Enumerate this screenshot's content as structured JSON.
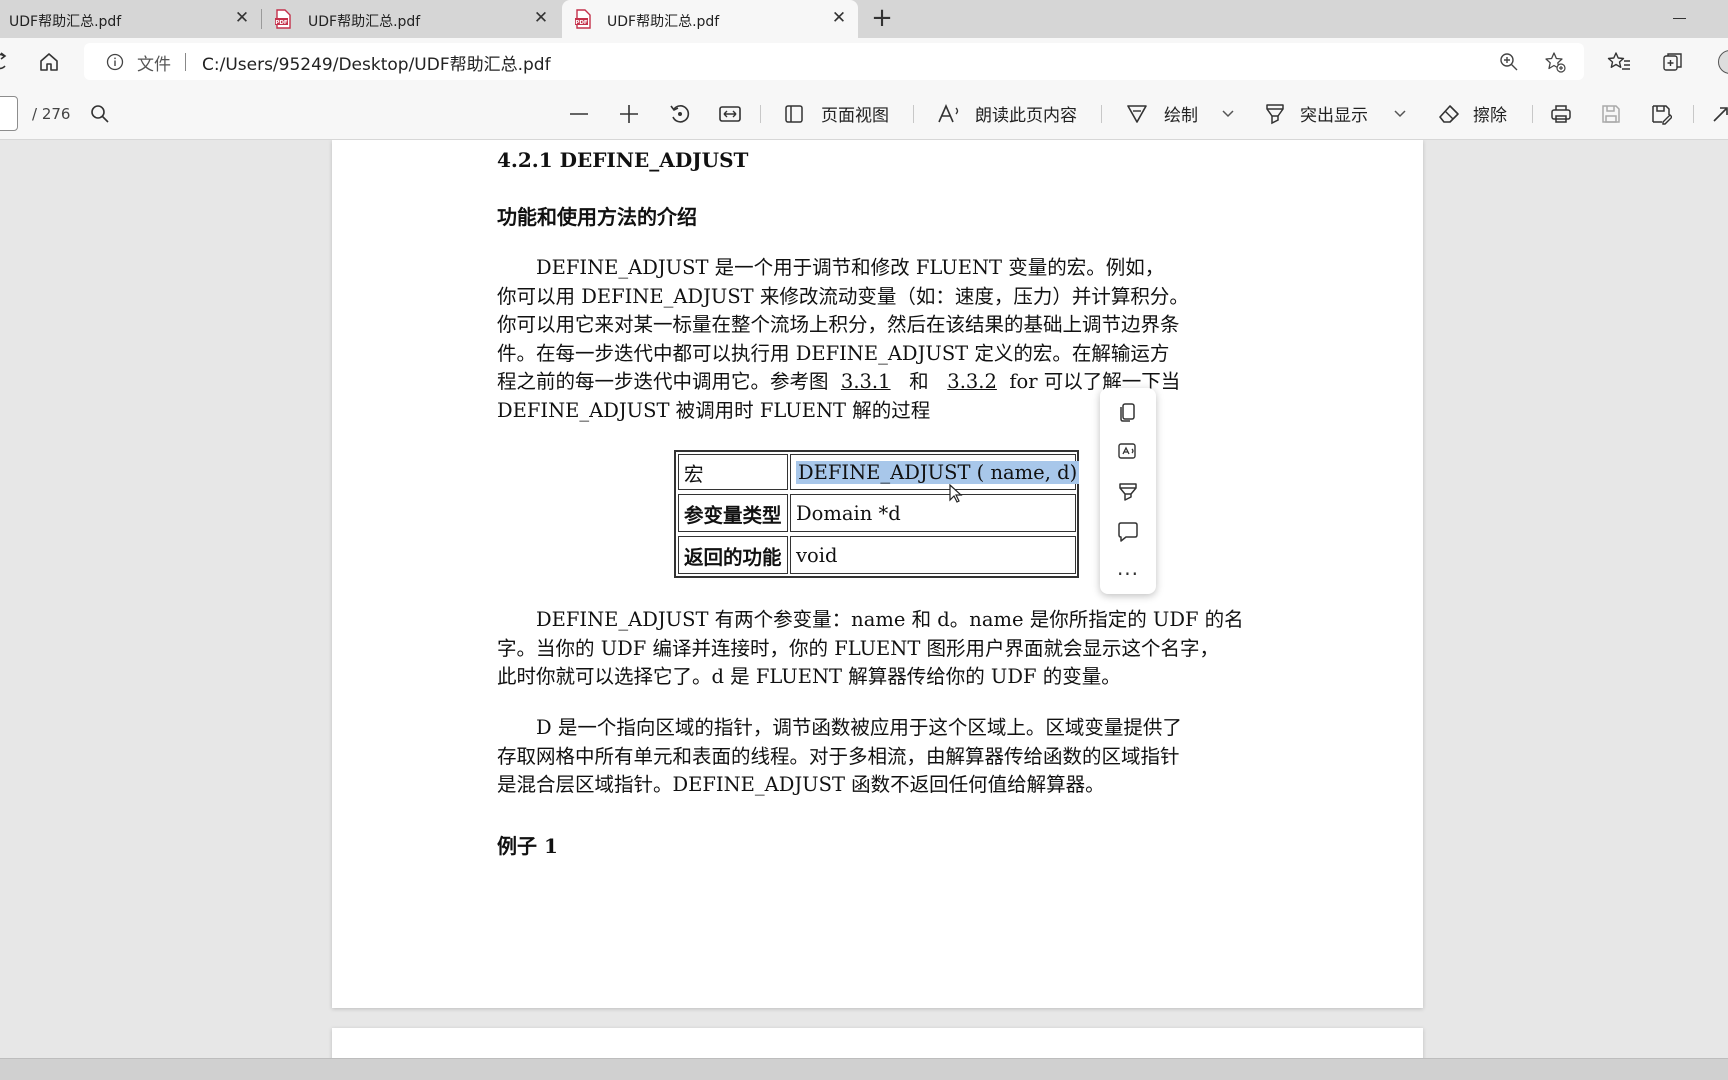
{
  "tabs": [
    {
      "title": "UDF帮助汇总.pdf"
    },
    {
      "title": "UDF帮助汇总.pdf"
    },
    {
      "title": "UDF帮助汇总.pdf"
    }
  ],
  "address": {
    "scheme_label": "文件",
    "url": "C:/Users/95249/Desktop/UDF帮助汇总.pdf"
  },
  "toolbar": {
    "page_total": "/ 276",
    "page_view": "页面视图",
    "read_aloud": "朗读此页内容",
    "draw": "绘制",
    "highlight": "突出显示",
    "erase": "擦除"
  },
  "doc": {
    "section_title": "4.2.1 DEFINE_ADJUST",
    "intro_heading": "功能和使用方法的介绍",
    "para1": [
      "DEFINE_ADJUST 是一个用于调节和修改 FLUENT 变量的宏。例如，",
      "你可以用 DEFINE_ADJUST 来修改流动变量（如：速度，压力）并计算积分。",
      "你可以用它来对某一标量在整个流场上积分，然后在该结果的基础上调节边界条",
      "件。在每一步迭代中都可以执行用 DEFINE_ADJUST 定义的宏。在解输运方",
      "程之前的每一步迭代中调用它。参考图",
      "3.3.1",
      "和",
      "3.3.2",
      "for 可以了解一下当",
      "DEFINE_ADJUST 被调用时 FLUENT 解的过程"
    ],
    "table": {
      "rows": [
        {
          "key": "宏",
          "value": "DEFINE_ADJUST ( name, d)"
        },
        {
          "key": "参变量类型",
          "value": "Domain *d"
        },
        {
          "key": "返回的功能",
          "value": "void"
        }
      ]
    },
    "para2": [
      "DEFINE_ADJUST 有两个参变量：name 和 d。name 是你所指定的 UDF 的名",
      "字。当你的 UDF 编译并连接时，你的 FLUENT 图形用户界面就会显示这个名字，",
      "此时你就可以选择它了。d 是 FLUENT 解算器传给你的 UDF 的变量。"
    ],
    "para3": [
      "D 是一个指向区域的指针，调节函数被应用于这个区域上。区域变量提供了",
      "存取网格中所有单元和表面的线程。对于多相流，由解算器传给函数的区域指针",
      "是混合层区域指针。DEFINE_ADJUST 函数不返回任何值给解算器。"
    ],
    "example_heading": "例子 1"
  },
  "mini_menu": {
    "more": "..."
  }
}
